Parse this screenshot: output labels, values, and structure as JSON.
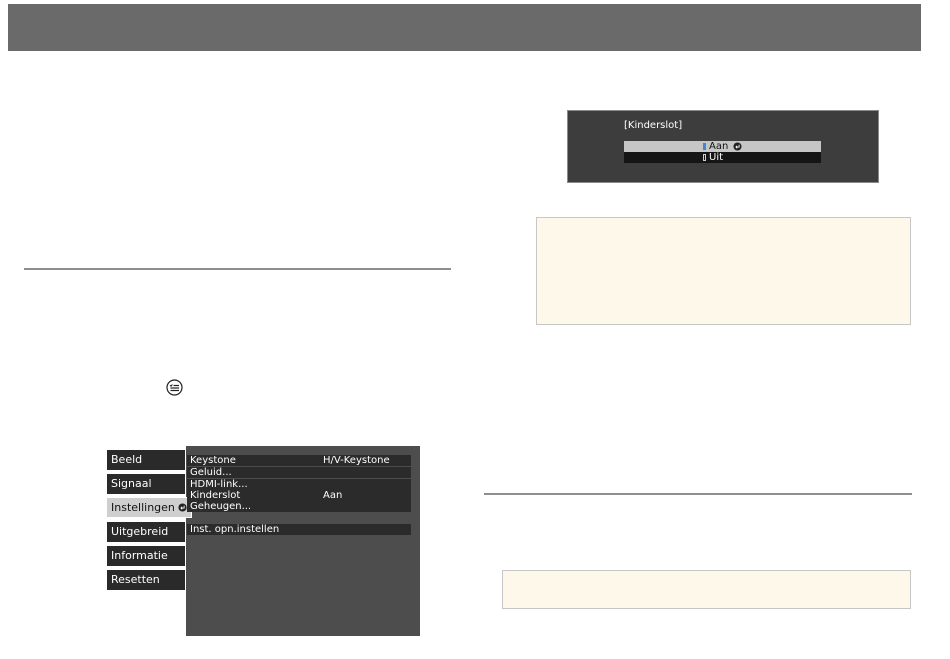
{
  "menu": {
    "tabs": [
      {
        "label": "Beeld"
      },
      {
        "label": "Signaal"
      },
      {
        "label": "Instellingen"
      },
      {
        "label": "Uitgebreid"
      },
      {
        "label": "Informatie"
      },
      {
        "label": "Resetten"
      }
    ],
    "selected_tab": "Instellingen",
    "rows": [
      {
        "label": "Keystone",
        "value": "H/V-Keystone"
      },
      {
        "label": "Geluid...",
        "value": ""
      },
      {
        "label": "HDMI-link...",
        "value": ""
      },
      {
        "label": "Kinderslot",
        "value": "Aan"
      },
      {
        "label": "Geheugen...",
        "value": ""
      },
      {
        "label": "Inst. opn.instellen",
        "value": ""
      }
    ]
  },
  "dialog": {
    "title": "[Kinderslot]",
    "options": [
      {
        "label": "Aan",
        "selected": true
      },
      {
        "label": "Uit",
        "selected": false
      }
    ]
  },
  "colors": {
    "topbar": "#6a6a6a",
    "note_background": "#fdf8ea",
    "menu_background": "#4d4d4d",
    "selection_marker": "#3f86d8"
  },
  "icons": {
    "menu_button": "menu-list-icon",
    "enter": "enter-icon"
  }
}
